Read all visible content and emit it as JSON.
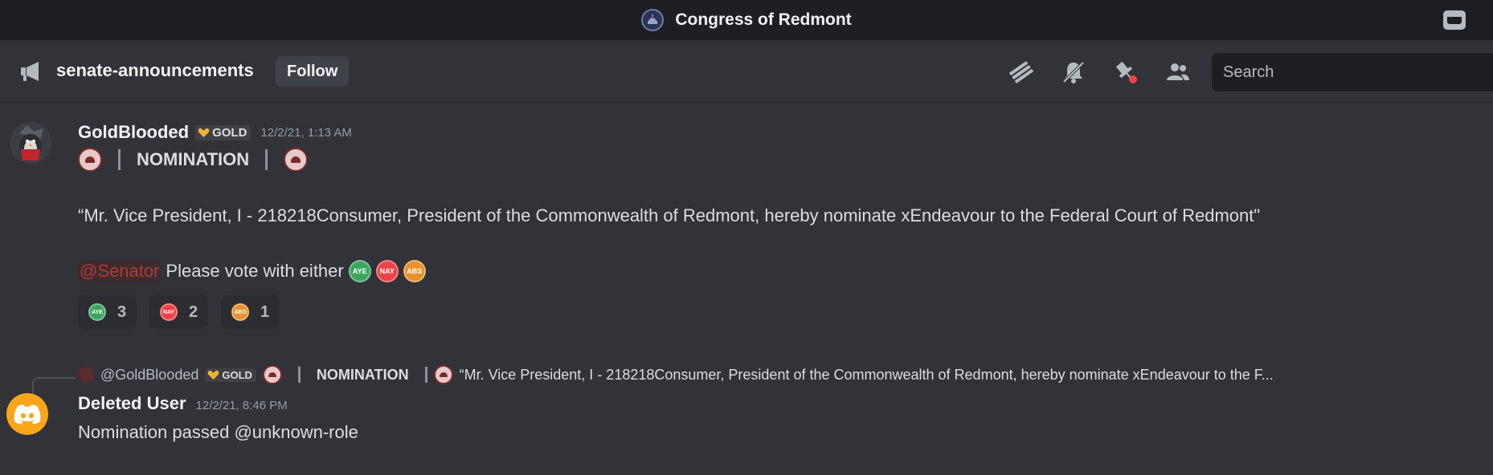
{
  "titlebar": {
    "server_name": "Congress of Redmont",
    "inbox_icon": "inbox-icon"
  },
  "header": {
    "channel_icon": "announcement-megaphone-icon",
    "channel_name": "senate-announcements",
    "follow_label": "Follow",
    "icons": [
      "threads-icon",
      "notification-muted-icon",
      "pinned-messages-icon",
      "member-list-icon"
    ],
    "search_placeholder": "Search"
  },
  "messages": [
    {
      "author": "GoldBlooded",
      "tag": "GOLD",
      "timestamp": "12/2/21, 1:13 AM",
      "heading": "NOMINATION",
      "quote": "“Mr.  Vice President, I - 218218Consumer, President of the Commonwealth of Redmont, hereby nominate xEndeavour to the Federal Court of Redmont\"",
      "mention": "@Senator",
      "vote_text": "Please vote with either",
      "vote_badges": [
        {
          "label": "AYE",
          "color": "#3ba55d"
        },
        {
          "label": "NAY",
          "color": "#ed4245"
        },
        {
          "label": "ABS",
          "color": "#e8912d"
        }
      ],
      "reactions": [
        {
          "label": "AYE",
          "color": "#3ba55d",
          "count": "3"
        },
        {
          "label": "NAY",
          "color": "#ed4245",
          "count": "2"
        },
        {
          "label": "ABS",
          "color": "#e8912d",
          "count": "1"
        }
      ]
    },
    {
      "reply": {
        "author": "@GoldBlooded",
        "tag": "GOLD",
        "heading": "NOMINATION",
        "snippet": "“Mr.  Vice President, I - 218218Consumer, President of the Commonwealth of Redmont, hereby nominate xEndeavour to the F..."
      },
      "author": "Deleted User",
      "timestamp": "12/2/21, 8:46 PM",
      "text": "Nomination passed @unknown-role"
    }
  ],
  "colors": {
    "brand": "#5865f2",
    "mention": "#b33a3a",
    "gold_heart": "#f0b232"
  }
}
